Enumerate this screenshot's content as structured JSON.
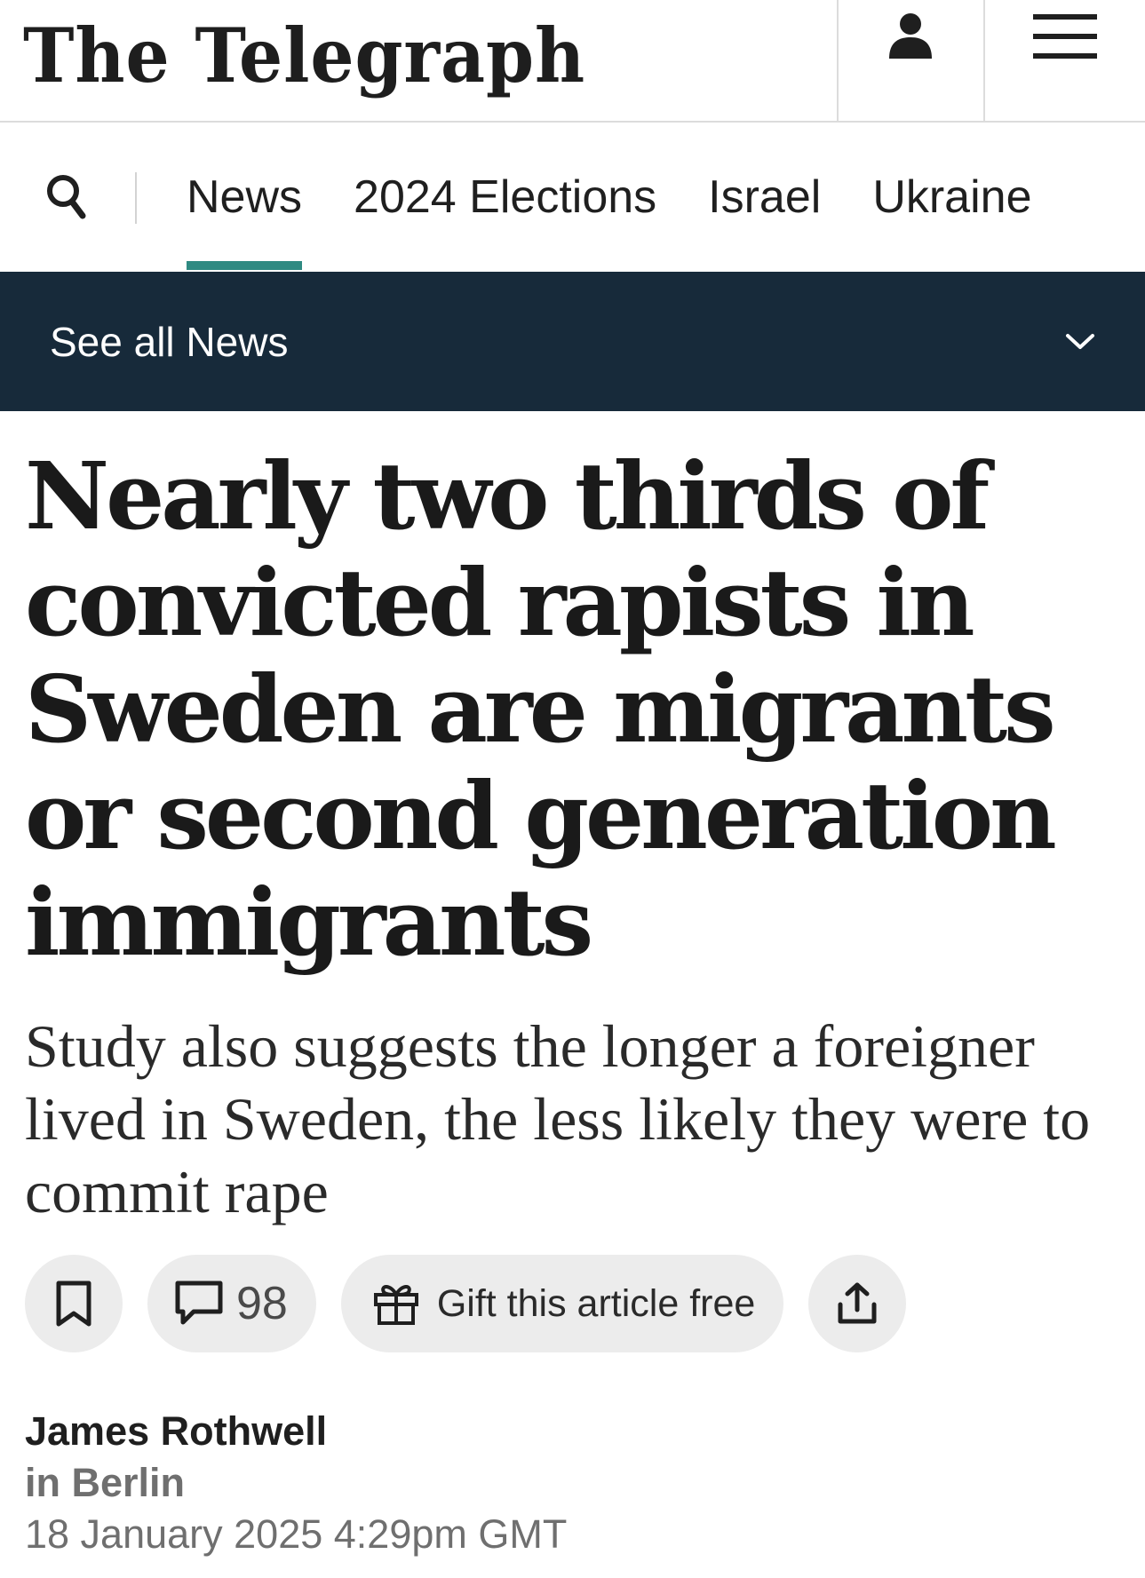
{
  "masthead": {
    "logo": "The Telegraph",
    "account_icon": "person-icon",
    "menu_icon": "hamburger-menu-icon"
  },
  "nav": {
    "search_icon": "search-icon",
    "tabs": [
      {
        "label": "News",
        "active": true
      },
      {
        "label": "2024 Elections",
        "active": false
      },
      {
        "label": "Israel",
        "active": false
      },
      {
        "label": "Ukraine",
        "active": false
      }
    ],
    "accent_color": "#2f8a82"
  },
  "subnav": {
    "label": "See all News",
    "chevron_icon": "chevron-down-icon",
    "background": "#172a3a"
  },
  "article": {
    "headline": "Nearly two thirds of convicted rapists in Sweden are migrants or second generation immigrants",
    "standfirst": "Study also suggests the longer a foreigner lived in Sweden, the less likely they were to commit rape",
    "actions": {
      "bookmark_icon": "bookmark-icon",
      "comment_icon": "comment-icon",
      "comment_count": "98",
      "gift_icon": "gift-icon",
      "gift_label": "Gift this article free",
      "share_icon": "share-icon"
    },
    "byline": {
      "author": "James Rothwell",
      "location": "in Berlin",
      "date": "18 January 2025 4:29pm GMT"
    }
  }
}
